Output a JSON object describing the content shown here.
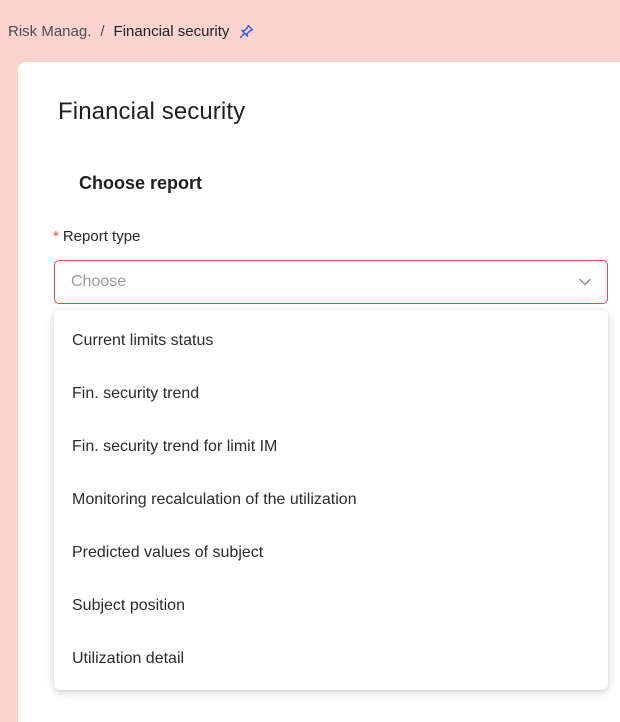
{
  "breadcrumb": {
    "parent": "Risk Manag.",
    "separator": "/",
    "current": "Financial security",
    "pin_icon": "pin-icon"
  },
  "page": {
    "title": "Financial security",
    "section_title": "Choose report"
  },
  "report_type": {
    "required_mark": "*",
    "label": "Report type",
    "placeholder": "Choose",
    "chevron_icon": "chevron-down-icon",
    "options": [
      "Current limits status",
      "Fin. security trend",
      "Fin. security trend for limit IM",
      "Monitoring recalculation of the utilization",
      "Predicted values of subject",
      "Subject position",
      "Utilization detail"
    ]
  },
  "colors": {
    "background": "#fbd3d1",
    "error": "#e5484d",
    "pin": "#3b5bdb"
  }
}
